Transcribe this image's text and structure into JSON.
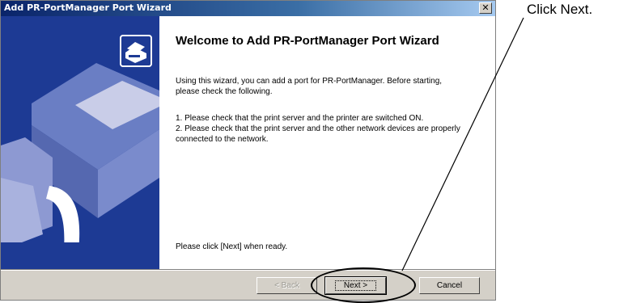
{
  "window": {
    "title": "Add PR-PortManager Port Wizard",
    "close_glyph": "✕"
  },
  "content": {
    "heading": "Welcome to Add PR-PortManager Port Wizard",
    "intro": "Using this wizard, you can add a port for PR-PortManager. Before starting, please check the following.",
    "check_1": "1. Please check that the print server and the printer are switched ON.",
    "check_2": "2. Please check that the print server and the other network devices are properly connected to the network.",
    "ready": "Please click [Next] when ready."
  },
  "buttons": {
    "back": "< Back",
    "next": "Next >",
    "cancel": "Cancel"
  },
  "annotation": {
    "callout": "Click Next."
  },
  "icons": [
    "printer-wizard-icon",
    "close-icon"
  ],
  "colors": {
    "titlebar_start": "#0a246a",
    "titlebar_end": "#a6caf0",
    "left_panel": "#1d3a94",
    "dialog_face": "#d4d0c8"
  }
}
